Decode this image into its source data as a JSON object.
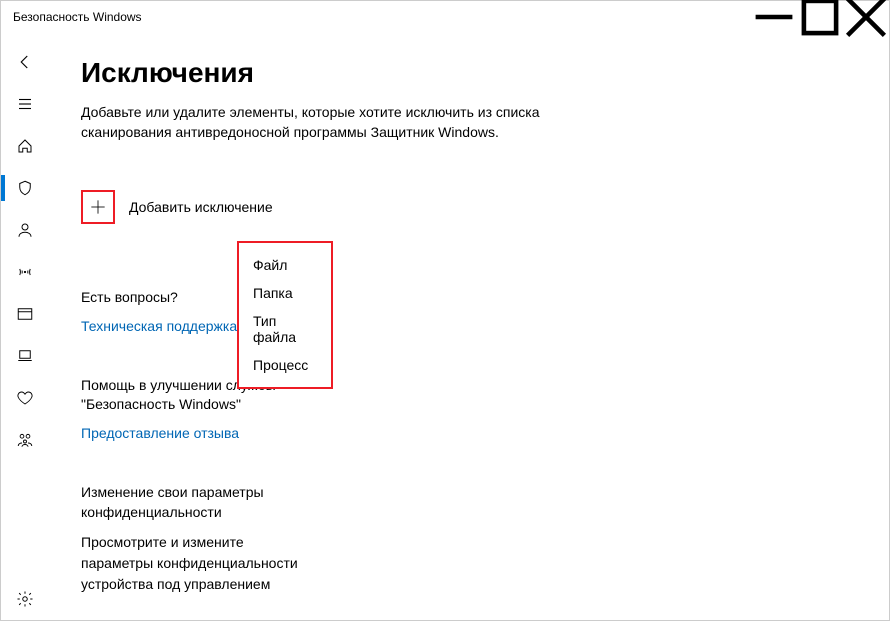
{
  "title": "Безопасность Windows",
  "page": {
    "heading": "Исключения",
    "description": "Добавьте или удалите элементы, которые хотите исключить из списка сканирования антивредоносной программы Защитник Windows.",
    "add_label": "Добавить исключение"
  },
  "dropdown": {
    "opt0": "Файл",
    "opt1": "Папка",
    "opt2": "Тип файла",
    "opt3": "Процесс"
  },
  "questions": {
    "heading": "Есть вопросы?",
    "link": "Техническая поддержка"
  },
  "improve": {
    "heading": "Помощь в улучшении службы \"Безопасность Windows\"",
    "link": "Предоставление отзыва"
  },
  "privacy": {
    "heading": "Изменение свои параметры конфиденциальности",
    "text": "Просмотрите и измените параметры конфиденциальности устройства под управлением"
  }
}
